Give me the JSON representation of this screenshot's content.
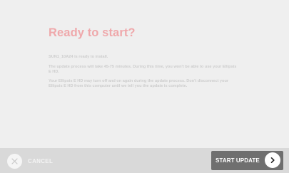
{
  "main": {
    "title": "Ready to start?",
    "paragraphs": [
      "SUN1_10A24 is ready to install.",
      "The update process will take 45-75 minutes. During this time, you won't be able to use your Ellipsis E HD.",
      "Your Ellipsis E HD may turn off and on again during the update process. Don't disconnect your Ellipsis E HD from this computer until we tell you the update is complete."
    ]
  },
  "footer": {
    "cancel_label": "CANCEL",
    "cancel_icon": "close-icon",
    "start_update_label": "START UPDATE",
    "start_update_icon": "chevron-right-icon"
  },
  "colors": {
    "title": "#efa8ab",
    "background": "#efefef",
    "footer_background": "#d9d9d9",
    "primary_button": "#6f6f6f"
  }
}
